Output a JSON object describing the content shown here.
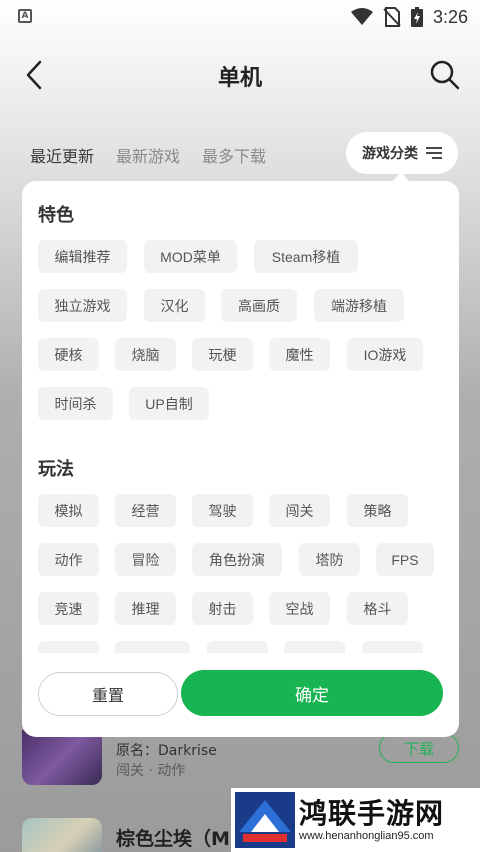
{
  "status_bar": {
    "time": "3:26",
    "app_icon_letter": "A"
  },
  "header": {
    "title": "单机"
  },
  "tabs": [
    {
      "label": "最近更新",
      "active": true
    },
    {
      "label": "最新游戏",
      "active": false
    },
    {
      "label": "最多下载",
      "active": false
    }
  ],
  "category_button": {
    "label": "游戏分类"
  },
  "panel": {
    "sections": [
      {
        "title": "特色",
        "tags": [
          "编辑推荐",
          "MOD菜单",
          "Steam移植",
          "独立游戏",
          "汉化",
          "高画质",
          "端游移植",
          "硬核",
          "烧脑",
          "玩梗",
          "魔性",
          "IO游戏",
          "时间杀",
          "UP自制"
        ]
      },
      {
        "title": "玩法",
        "tags": [
          "模拟",
          "经营",
          "驾驶",
          "闯关",
          "策略",
          "动作",
          "冒险",
          "角色扮演",
          "塔防",
          "FPS",
          "竞速",
          "推理",
          "射击",
          "空战",
          "格斗"
        ]
      }
    ],
    "reset_label": "重置",
    "confirm_label": "确定"
  },
  "list": {
    "item1": {
      "origin": "原名：Darkrise",
      "tags": "闯关 · 动作",
      "download_label": "下载"
    },
    "item2": {
      "name": "棕色尘埃（M"
    }
  },
  "watermark": {
    "title": "鸿联手游网",
    "url": "www.henanhonglian95.com"
  },
  "colors": {
    "accent": "#18b451",
    "tag_bg": "#f2f2f2",
    "active_underline": "#2ecc71"
  }
}
